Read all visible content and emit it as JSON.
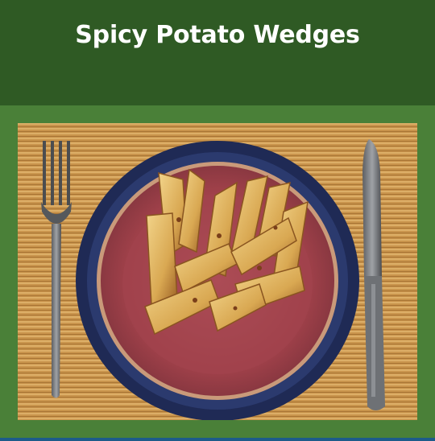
{
  "recipe": {
    "title": "Spicy Potato Wedges"
  },
  "photo": {
    "alt": "Spicy Potato Wedges",
    "subjects": [
      "fork-icon",
      "plate",
      "potato-wedges",
      "knife-icon",
      "bamboo-placemat"
    ]
  },
  "colors": {
    "header_bg": "#2f5a24",
    "frame_bg": "#4a8038",
    "title_text": "#ffffff",
    "bottom_bar": "#1d5b8a"
  }
}
